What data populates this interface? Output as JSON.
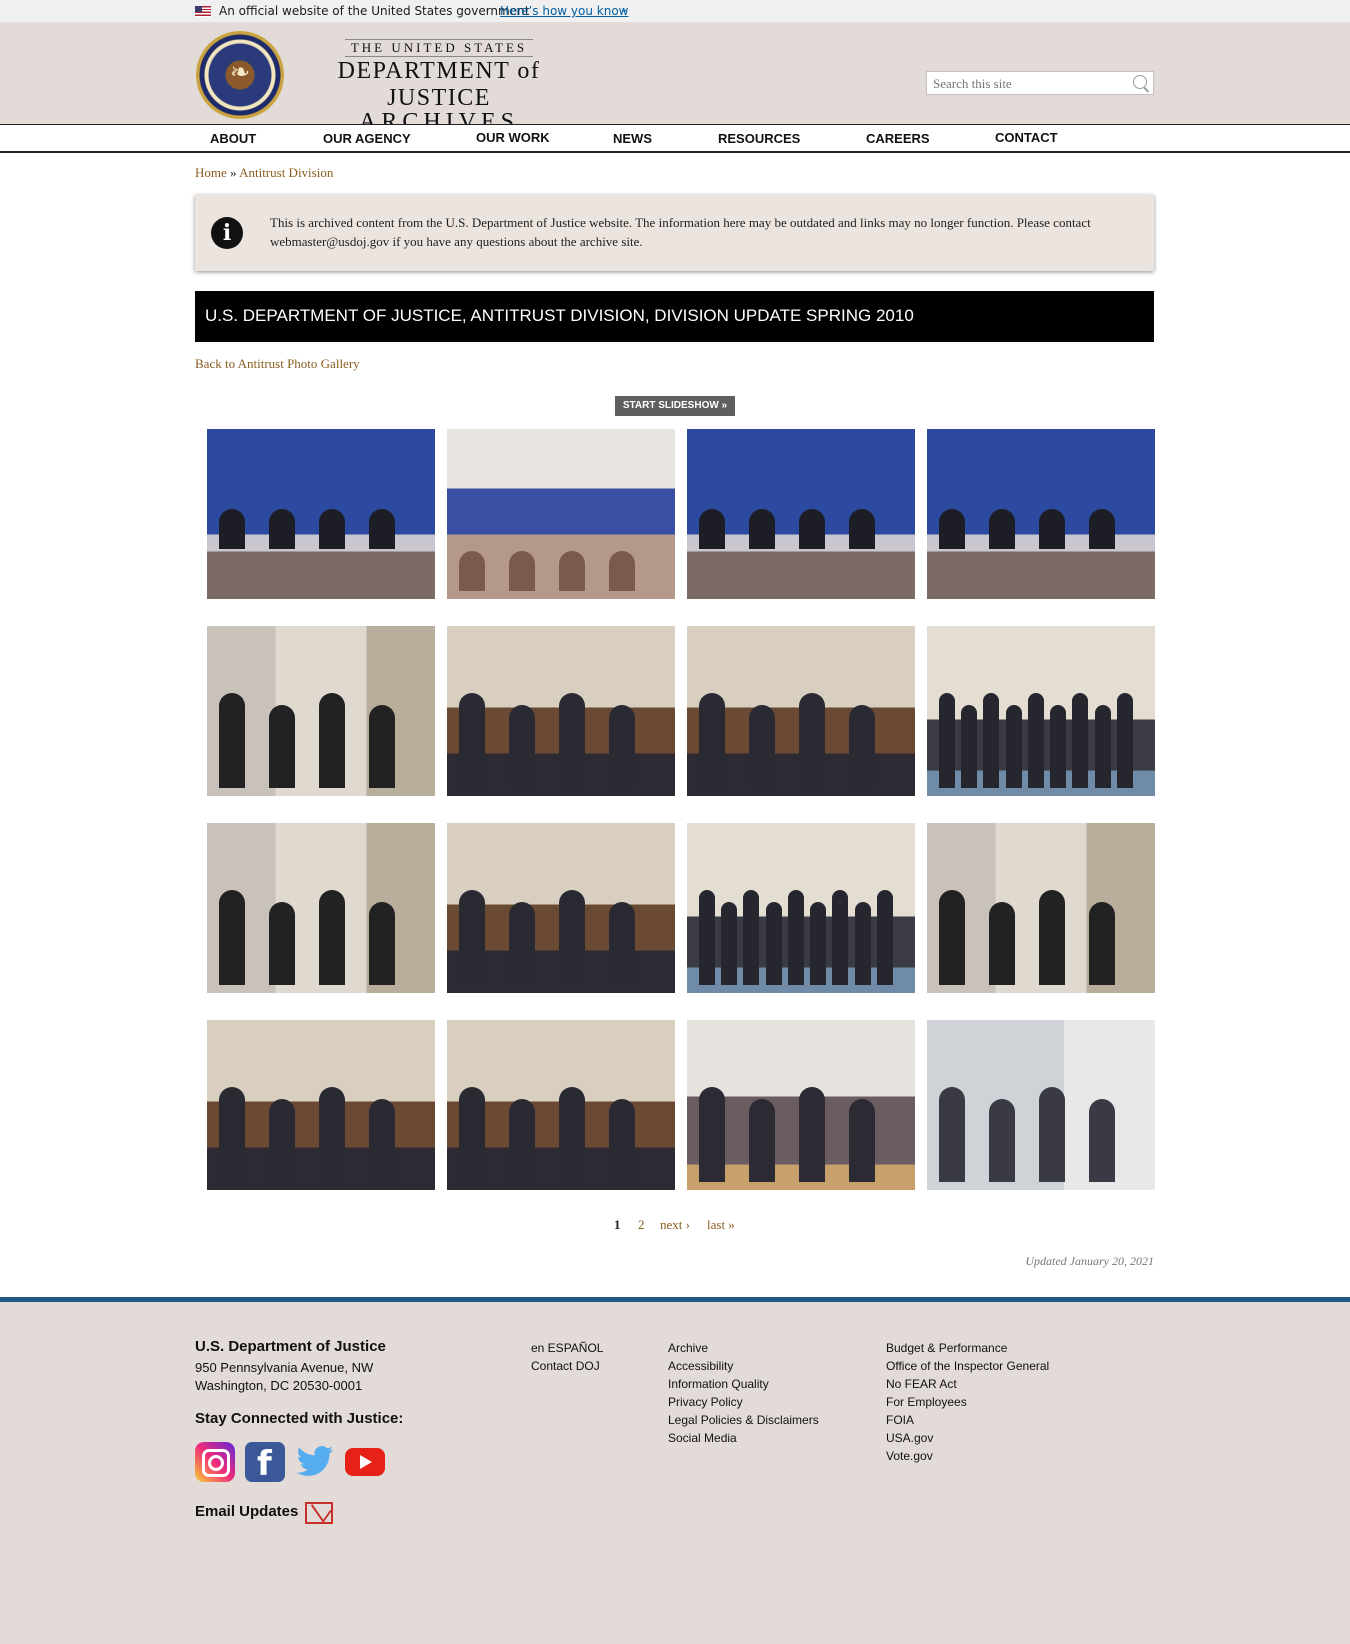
{
  "gov_banner": {
    "text": "An official website of the United States government",
    "link": "Here’s how you know"
  },
  "logo": {
    "line1": "THE UNITED STATES",
    "line2": "DEPARTMENT of JUSTICE",
    "line3": "ARCHIVES"
  },
  "search": {
    "placeholder": "Search this site"
  },
  "nav": [
    "ABOUT",
    "OUR AGENCY",
    "OUR WORK",
    "NEWS",
    "RESOURCES",
    "CAREERS",
    "CONTACT"
  ],
  "breadcrumb": {
    "home": "Home",
    "separator": "»",
    "current": "Antitrust Division"
  },
  "notice": "This is archived content from the U.S. Department of Justice website. The information here may be outdated and links may no longer function. Please contact webmaster@usdoj.gov if you have any questions about the archive site.",
  "page_title": "U.S. DEPARTMENT OF JUSTICE, ANTITRUST DIVISION, DIVISION UPDATE SPRING 2010",
  "back_link": "Back to Antitrust Photo Gallery",
  "slideshow_button": "START SLIDESHOW »",
  "gallery": {
    "thumbnails": [
      {
        "scene": "panel"
      },
      {
        "scene": "auditorium"
      },
      {
        "scene": "panel"
      },
      {
        "scene": "panel"
      },
      {
        "scene": "office"
      },
      {
        "scene": "meeting"
      },
      {
        "scene": "meeting"
      },
      {
        "scene": "group"
      },
      {
        "scene": "office"
      },
      {
        "scene": "meeting"
      },
      {
        "scene": "group"
      },
      {
        "scene": "office"
      },
      {
        "scene": "meeting"
      },
      {
        "scene": "meeting"
      },
      {
        "scene": "podium"
      },
      {
        "scene": "seated"
      }
    ]
  },
  "pager": {
    "current": "1",
    "page2": "2",
    "next": "next ›",
    "last": "last »"
  },
  "updated": "Updated January 20, 2021",
  "footer": {
    "org": "U.S. Department of Justice",
    "address_line1": "950 Pennsylvania Avenue, NW",
    "address_line2": "Washington, DC 20530-0001",
    "stay_connected": "Stay Connected with Justice:",
    "social": [
      "instagram-icon",
      "facebook-icon",
      "twitter-icon",
      "youtube-icon"
    ],
    "email_updates": "Email Updates",
    "col1": [
      "en ESPAÑOL",
      "Contact DOJ"
    ],
    "col2": [
      "Archive",
      "Accessibility",
      "Information Quality",
      "Privacy Policy",
      "Legal Policies & Disclaimers",
      "Social Media"
    ],
    "col3": [
      "Budget & Performance",
      "Office of the Inspector General",
      "No FEAR Act",
      "For Employees",
      "FOIA",
      "USA.gov",
      "Vote.gov"
    ]
  },
  "colors": {
    "accent_link": "#8a5c20",
    "header_bg": "#e2dbd7",
    "footer_rule": "#1f5a83"
  }
}
